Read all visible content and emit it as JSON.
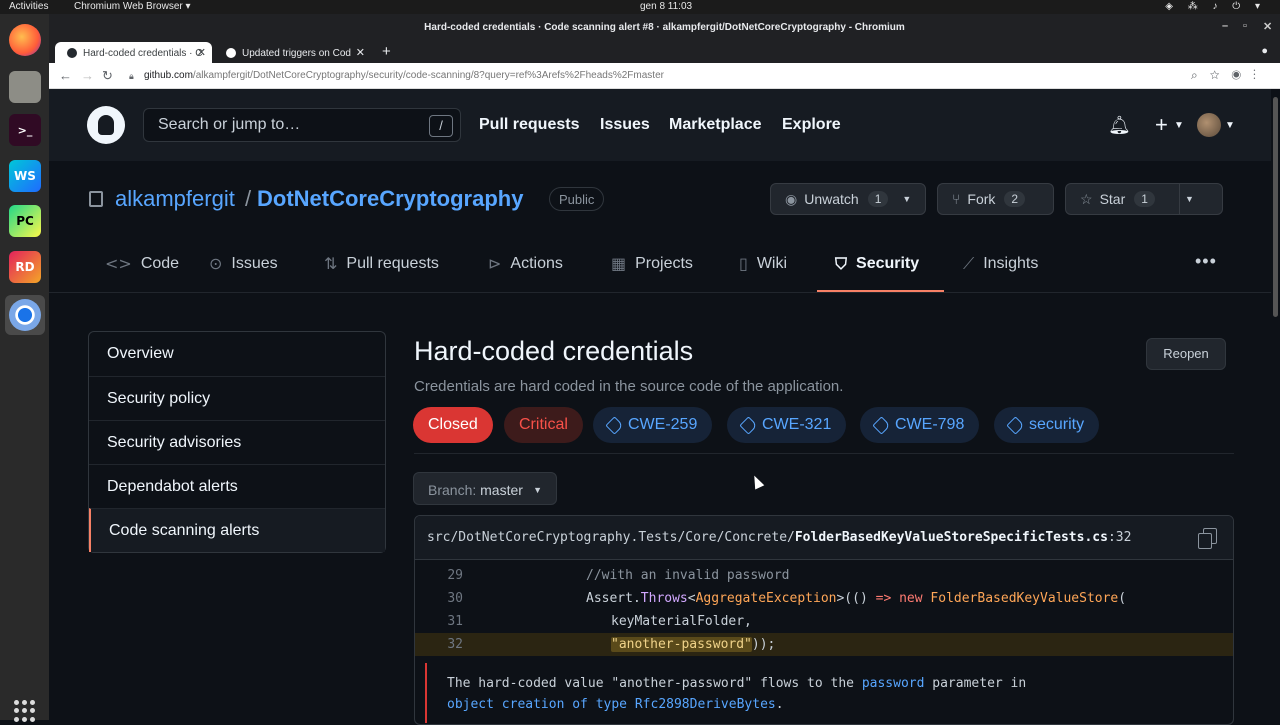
{
  "os": {
    "activities": "Activities",
    "app_menu": "Chromium Web Browser ▾",
    "clock": "gen 8  11:03"
  },
  "dock": {
    "apps": [
      {
        "name": "Firefox",
        "glyph": ""
      },
      {
        "name": "Files",
        "glyph": ""
      },
      {
        "name": "Terminal",
        "glyph": ">_"
      },
      {
        "name": "WebStorm",
        "glyph": "WS"
      },
      {
        "name": "PyCharm",
        "glyph": "PC"
      },
      {
        "name": "Rider",
        "glyph": "RD"
      },
      {
        "name": "Chromium",
        "glyph": ""
      }
    ]
  },
  "browser": {
    "window_title": "Hard-coded credentials · Code scanning alert #8 · alkampfergit/DotNetCoreCryptography - Chromium",
    "tabs": [
      {
        "label": "Hard-coded credentials · C"
      },
      {
        "label": "Updated triggers on Cod"
      }
    ],
    "url_host": "github.com",
    "url_path": "/alkampfergit/DotNetCoreCryptography/security/code-scanning/8?query=ref%3Arefs%2Fheads%2Fmaster"
  },
  "github": {
    "search_placeholder": "Search or jump to…",
    "search_shortcut": "/",
    "nav": [
      "Pull requests",
      "Issues",
      "Marketplace",
      "Explore"
    ]
  },
  "repo": {
    "owner": "alkampfergit",
    "separator": "/",
    "name": "DotNetCoreCryptography",
    "visibility": "Public",
    "unwatch": {
      "label": "Unwatch",
      "count": "1"
    },
    "fork": {
      "label": "Fork",
      "count": "2"
    },
    "star": {
      "label": "Star",
      "count": "1"
    },
    "tabs": [
      "Code",
      "Issues",
      "Pull requests",
      "Actions",
      "Projects",
      "Wiki",
      "Security",
      "Insights"
    ]
  },
  "sidebar": {
    "items": [
      {
        "label": "Overview"
      },
      {
        "label": "Security policy"
      },
      {
        "label": "Security advisories"
      },
      {
        "label": "Dependabot alerts"
      },
      {
        "label": "Code scanning alerts"
      }
    ]
  },
  "alert": {
    "title": "Hard-coded credentials",
    "description": "Credentials are hard coded in the source code of the application.",
    "reopen_label": "Reopen",
    "state": "Closed",
    "severity": "Critical",
    "tags": [
      "CWE-259",
      "CWE-321",
      "CWE-798",
      "security"
    ],
    "branch_label": "Branch:",
    "branch_value": "master",
    "file_path": "src/DotNetCoreCryptography.Tests/Core/Concrete/",
    "file_name": "FolderBasedKeyValueStoreSpecificTests.cs",
    "file_line": ":32",
    "code": [
      {
        "ln": "29"
      },
      {
        "ln": "30"
      },
      {
        "ln": "31"
      },
      {
        "ln": "32"
      }
    ],
    "message_1": "The hard-coded value \"another-password\" flows to the",
    "message_param": "password",
    "message_2": "parameter in",
    "message_link": "object creation of type Rfc2898DeriveBytes",
    "message_end": "."
  }
}
